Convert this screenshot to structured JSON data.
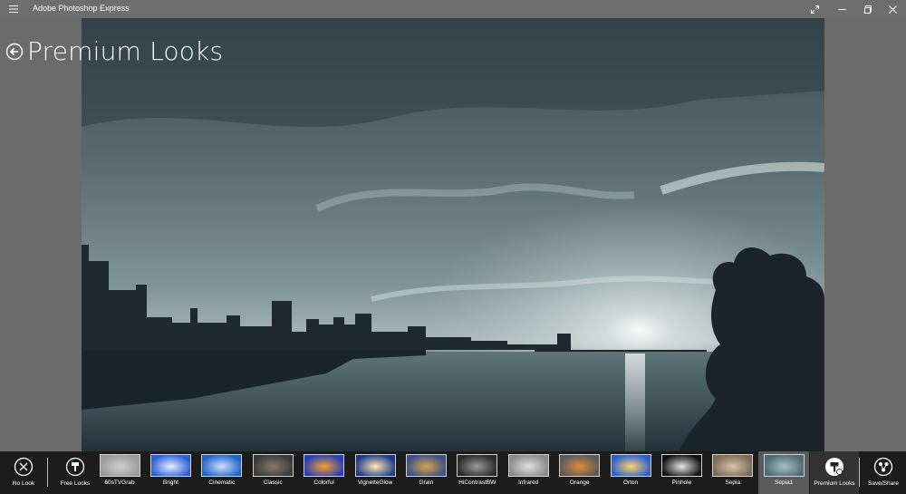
{
  "window": {
    "title": "Adobe Photoshop Express"
  },
  "header": {
    "page_title": "Premium Looks"
  },
  "toolbar": {
    "no_look": "No Look",
    "free_looks": "Free Looks",
    "premium_looks": "Premium Looks",
    "save_share": "Save/Share"
  },
  "looks": [
    {
      "label": "60sTVGrab",
      "colors": [
        "#9a9a9a",
        "#cfcfcf"
      ]
    },
    {
      "label": "Bright",
      "colors": [
        "#2a5fd6",
        "#e6ecff"
      ]
    },
    {
      "label": "Cinematic",
      "colors": [
        "#1f64c8",
        "#cfe0ff"
      ]
    },
    {
      "label": "Classic",
      "colors": [
        "#3a3a3a",
        "#8a7a6a"
      ]
    },
    {
      "label": "Colorful",
      "colors": [
        "#2b3fb5",
        "#f2a030"
      ]
    },
    {
      "label": "VignetteGlow",
      "colors": [
        "#1d3a8c",
        "#ffe9b0"
      ]
    },
    {
      "label": "Grain",
      "colors": [
        "#3a4f8a",
        "#d7a44a"
      ]
    },
    {
      "label": "HiContrastBW",
      "colors": [
        "#2a2a2a",
        "#9a9a9a"
      ]
    },
    {
      "label": "Infrared",
      "colors": [
        "#8a8a8a",
        "#e0e0e0"
      ]
    },
    {
      "label": "Orange",
      "colors": [
        "#5a5a5a",
        "#e08a3a"
      ]
    },
    {
      "label": "Orton",
      "colors": [
        "#2b5fd0",
        "#ffd36b"
      ]
    },
    {
      "label": "Pinhole",
      "colors": [
        "#111111",
        "#e8e8e8"
      ]
    },
    {
      "label": "Sepia",
      "colors": [
        "#7a6a58",
        "#d8c3a8"
      ]
    },
    {
      "label": "Sepia1",
      "colors": [
        "#4d6a72",
        "#a9bfc2"
      ]
    }
  ],
  "selected_look": "Sepia1",
  "colors": {
    "titlebar": "#6e6e6e",
    "background": "#6b6b6b",
    "toolbar": "#1c1c1c",
    "selected": "#5a5a5a"
  }
}
